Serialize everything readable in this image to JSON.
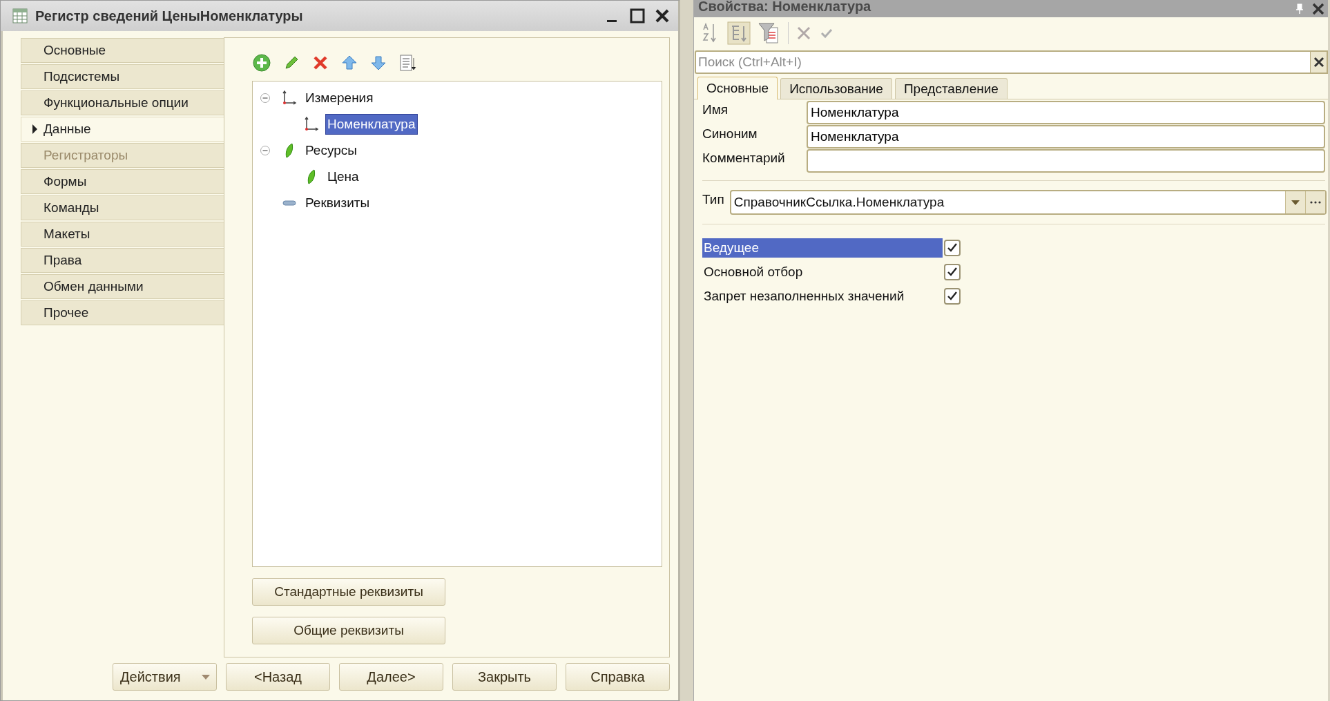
{
  "designer": {
    "title": "Регистр сведений ЦеныНоменклатуры",
    "sidebar": {
      "items": [
        {
          "label": "Основные",
          "selected": false,
          "disabled": false
        },
        {
          "label": "Подсистемы",
          "selected": false,
          "disabled": false
        },
        {
          "label": "Функциональные опции",
          "selected": false,
          "disabled": false
        },
        {
          "label": "Данные",
          "selected": true,
          "disabled": false
        },
        {
          "label": "Регистраторы",
          "selected": false,
          "disabled": true
        },
        {
          "label": "Формы",
          "selected": false,
          "disabled": false
        },
        {
          "label": "Команды",
          "selected": false,
          "disabled": false
        },
        {
          "label": "Макеты",
          "selected": false,
          "disabled": false
        },
        {
          "label": "Права",
          "selected": false,
          "disabled": false
        },
        {
          "label": "Обмен данными",
          "selected": false,
          "disabled": false
        },
        {
          "label": "Прочее",
          "selected": false,
          "disabled": false
        }
      ]
    },
    "tree": [
      {
        "label": "Измерения",
        "kind": "dimension",
        "expanded": true,
        "selected": false,
        "children": [
          {
            "label": "Номенклатура",
            "kind": "dimension",
            "selected": true
          }
        ]
      },
      {
        "label": "Ресурсы",
        "kind": "resource",
        "expanded": true,
        "selected": false,
        "children": [
          {
            "label": "Цена",
            "kind": "resource",
            "selected": false
          }
        ]
      },
      {
        "label": "Реквизиты",
        "kind": "attribute",
        "selected": false
      }
    ],
    "panel_buttons": [
      "Стандартные реквизиты",
      "Общие реквизиты"
    ],
    "footer_buttons": [
      {
        "label": "Действия",
        "kind": "menu"
      },
      {
        "label": "<Назад",
        "kind": "plain"
      },
      {
        "label": "Далее>",
        "kind": "plain"
      },
      {
        "label": "Закрыть",
        "kind": "plain"
      },
      {
        "label": "Справка",
        "kind": "plain"
      }
    ]
  },
  "properties": {
    "title": "Свойства: Номенклатура",
    "search": {
      "placeholder": "Поиск (Ctrl+Alt+I)"
    },
    "tabs": [
      {
        "label": "Основные",
        "selected": true
      },
      {
        "label": "Использование",
        "selected": false
      },
      {
        "label": "Представление",
        "selected": false
      }
    ],
    "fields": [
      {
        "label": "Имя",
        "value": "Номенклатура"
      },
      {
        "label": "Синоним",
        "value": "Номенклатура"
      },
      {
        "label": "Комментарий"
      }
    ],
    "type_field": {
      "label": "Тип",
      "value": "СправочникСсылка.Номенклатура"
    },
    "flags": [
      {
        "label": "Ведущее",
        "checked": true,
        "selected": true
      },
      {
        "label": "Основной отбор",
        "checked": true,
        "selected": false
      },
      {
        "label": "Запрет незаполненных значений",
        "checked": true,
        "selected": false
      }
    ]
  }
}
